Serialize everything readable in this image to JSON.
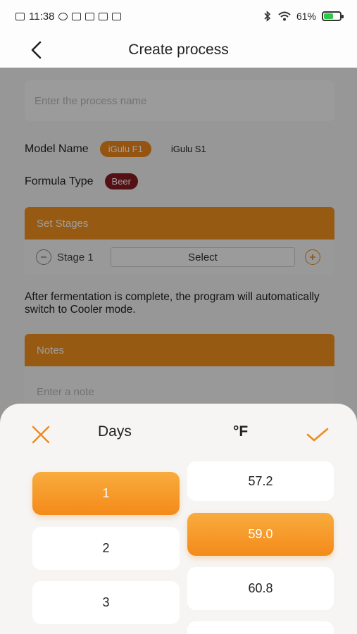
{
  "status_bar": {
    "time": "11:38",
    "battery_percent": "61%",
    "battery_level": 0.61
  },
  "header": {
    "title": "Create process"
  },
  "form": {
    "process_name_placeholder": "Enter the process name",
    "model_label": "Model Name",
    "models": [
      "iGulu F1",
      "iGulu S1"
    ],
    "selected_model": "iGulu F1",
    "formula_label": "Formula Type",
    "formula_value": "Beer",
    "stages_title": "Set Stages",
    "stage_label": "Stage 1",
    "stage_select": "Select",
    "info_text": "After fermentation is complete, the program will automatically switch to Cooler mode.",
    "notes_title": "Notes",
    "notes_placeholder": "Enter a note"
  },
  "sheet": {
    "days_title": "Days",
    "temp_title": "°F",
    "days": [
      "1",
      "2",
      "3"
    ],
    "selected_day": "1",
    "temps": [
      "57.2",
      "59.0",
      "60.8"
    ],
    "selected_temp": "59.0"
  },
  "colors": {
    "accent": "#f4921e",
    "beer_chip": "#8a1a22",
    "battery": "#2fc94a"
  }
}
